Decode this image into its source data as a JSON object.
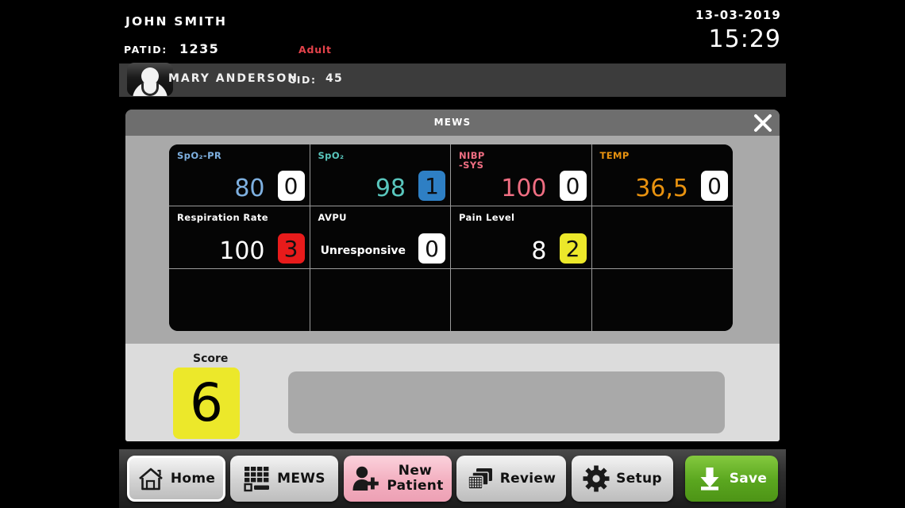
{
  "header": {
    "patient_name": "JOHN SMITH",
    "patid_label": "PATID:",
    "patid_value": "1235",
    "patient_type": "Adult",
    "date": "13-03-2019",
    "time": "15:29"
  },
  "clinician": {
    "name": "MARY ANDERSON",
    "cid_label": "CID:",
    "cid_value": "45",
    "avatar_icon": "clinician-avatar-icon"
  },
  "dialog": {
    "title": "MEWS",
    "close_icon": "close-icon"
  },
  "parameters": [
    {
      "label": "SpO₂-PR",
      "label_color": "#7eb0e0",
      "value": "80",
      "value_color": "#7eb0e0",
      "score": "0",
      "score_bg": "#ffffff",
      "score_fg": "#111111",
      "value_style": "large"
    },
    {
      "label": "SpO₂",
      "label_color": "#59c6bd",
      "value": "98",
      "value_color": "#59c6bd",
      "score": "1",
      "score_bg": "#2e7fc4",
      "score_fg": "#0d0d0d",
      "value_style": "large"
    },
    {
      "label": "NIBP\n-SYS",
      "label_color": "#ef6e82",
      "value": "100",
      "value_color": "#ef6e82",
      "score": "0",
      "score_bg": "#ffffff",
      "score_fg": "#111111",
      "value_style": "large"
    },
    {
      "label": "TEMP",
      "label_color": "#e8920f",
      "value": "36,5",
      "value_color": "#e8920f",
      "score": "0",
      "score_bg": "#ffffff",
      "score_fg": "#111111",
      "value_style": "large"
    },
    {
      "label": "Respiration Rate",
      "label_color": "#ffffff",
      "value": "100",
      "value_color": "#ffffff",
      "score": "3",
      "score_bg": "#e81b1b",
      "score_fg": "#111111",
      "value_style": "large"
    },
    {
      "label": "AVPU",
      "label_color": "#ffffff",
      "value": "Unresponsive",
      "value_color": "#ffffff",
      "score": "0",
      "score_bg": "#ffffff",
      "score_fg": "#111111",
      "value_style": "small"
    },
    {
      "label": "Pain Level",
      "label_color": "#ffffff",
      "value": "8",
      "value_color": "#ffffff",
      "score": "2",
      "score_bg": "#ece82a",
      "score_fg": "#111111",
      "value_style": "large"
    },
    {
      "label": "",
      "label_color": "#ffffff",
      "value": "",
      "value_color": "#ffffff",
      "score": "",
      "score_bg": "transparent",
      "score_fg": "#111111",
      "value_style": "large"
    },
    {
      "label": "",
      "label_color": "#fff",
      "value": "",
      "value_color": "#fff",
      "score": "",
      "score_bg": "transparent",
      "score_fg": "#111",
      "value_style": "large"
    },
    {
      "label": "",
      "label_color": "#fff",
      "value": "",
      "value_color": "#fff",
      "score": "",
      "score_bg": "transparent",
      "score_fg": "#111",
      "value_style": "large"
    },
    {
      "label": "",
      "label_color": "#fff",
      "value": "",
      "value_color": "#fff",
      "score": "",
      "score_bg": "transparent",
      "score_fg": "#111",
      "value_style": "large"
    },
    {
      "label": "",
      "label_color": "#fff",
      "value": "",
      "value_color": "#fff",
      "score": "",
      "score_bg": "transparent",
      "score_fg": "#111",
      "value_style": "large"
    }
  ],
  "score_panel": {
    "label": "Score",
    "value": "6",
    "badge_color": "#ece82a"
  },
  "nav": [
    {
      "label": "Home",
      "icon": "home-icon",
      "style": "light",
      "selected": true
    },
    {
      "label": "MEWS",
      "icon": "grid-table-icon",
      "style": "light",
      "selected": false
    },
    {
      "label": "New\nPatient",
      "icon": "add-person-icon",
      "style": "pink",
      "selected": false
    },
    {
      "label": "Review",
      "icon": "review-pages-icon",
      "style": "light",
      "selected": false
    },
    {
      "label": "Setup",
      "icon": "gear-icon",
      "style": "light",
      "selected": false
    },
    {
      "label": "Save",
      "icon": "download-save-icon",
      "style": "green",
      "selected": false
    }
  ]
}
